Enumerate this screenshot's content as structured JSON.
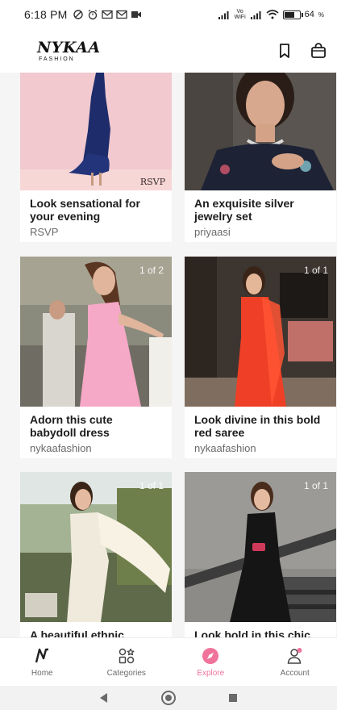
{
  "status_bar": {
    "time": "6:18 PM",
    "icons_left": [
      "data-saver-icon",
      "alarm-icon",
      "gmail-icon",
      "gmail-icon",
      "video-icon"
    ],
    "icons_right": [
      "signal-icon",
      "vowifi-icon",
      "signal-icon",
      "wifi-icon",
      "battery-icon"
    ],
    "vowifi": "Vo WiFi",
    "battery_percent": "64",
    "battery_level": 0.64
  },
  "header": {
    "logo_line1": "NYKAA",
    "logo_line2": "FASHION",
    "icons": [
      "bookmark-icon",
      "shopping-bag-icon"
    ]
  },
  "feed": {
    "cards": [
      {
        "caption": "Look sensational for your evening",
        "source": "RSVP",
        "counter": "",
        "watermark": "RSVP"
      },
      {
        "caption": "An exquisite silver jewelry set",
        "source": "priyaasi",
        "counter": ""
      },
      {
        "caption": "Adorn this cute babydoll dress",
        "source": "nykaafashion",
        "counter": "1 of 2"
      },
      {
        "caption": "Look divine in this bold red saree",
        "source": "nykaafashion",
        "counter": "1 of 1"
      },
      {
        "caption": "A beautiful ethnic",
        "source": "",
        "counter": "1 of 1"
      },
      {
        "caption": "Look bold in this chic",
        "source": "",
        "counter": "1 of 1"
      }
    ]
  },
  "bottom_nav": {
    "items": [
      {
        "label": "Home",
        "icon": "nykaa-n-icon"
      },
      {
        "label": "Categories",
        "icon": "categories-grid-icon"
      },
      {
        "label": "Explore",
        "icon": "compass-icon",
        "active": true
      },
      {
        "label": "Account",
        "icon": "account-icon"
      }
    ],
    "accent_color": "#f0739b"
  },
  "system_nav": {
    "icons": [
      "back-icon",
      "home-circle-icon",
      "recents-icon"
    ]
  }
}
